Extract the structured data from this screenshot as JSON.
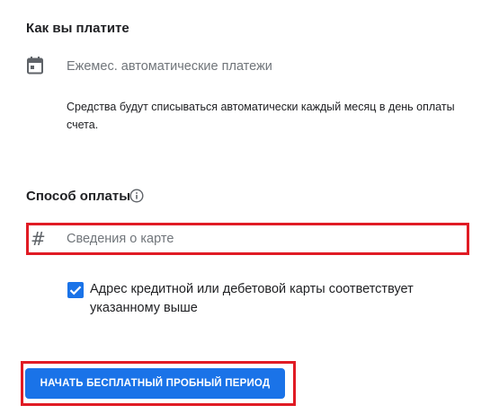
{
  "payment_schedule": {
    "title": "Как вы платите",
    "icon": "calendar-icon",
    "method_label": "Ежемес. автоматические платежи",
    "description": "Средства будут списываться автоматически каждый месяц в день оплаты счета."
  },
  "payment_method": {
    "title": "Способ оплаты",
    "info_icon": "info-icon",
    "card_field": {
      "icon": "hash-icon",
      "placeholder": "Сведения о карте",
      "value": ""
    },
    "address_checkbox": {
      "checked": true,
      "label": "Адрес кредитной или дебетовой карты соответствует указанному выше"
    }
  },
  "cta": {
    "label": "НАЧАТЬ БЕСПЛАТНЫЙ ПРОБНЫЙ ПЕРИОД"
  },
  "colors": {
    "accent": "#1a73e8",
    "highlight": "#e01b24",
    "muted_text": "#70757a"
  }
}
